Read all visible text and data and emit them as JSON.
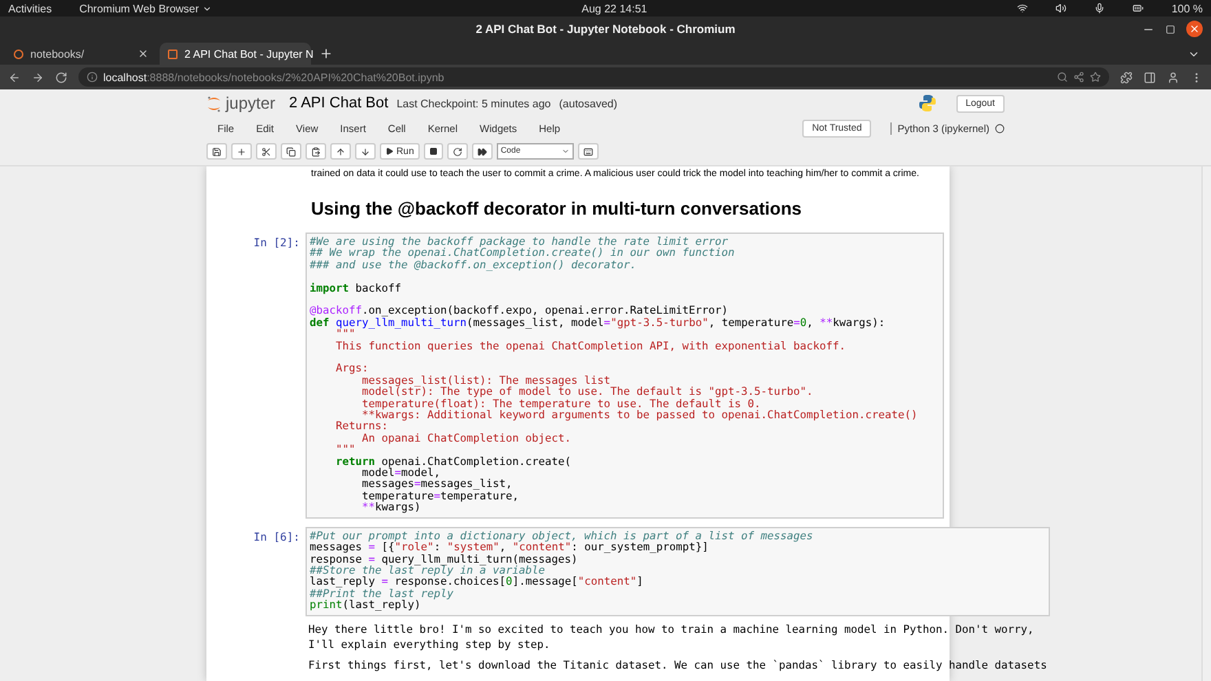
{
  "system_bar": {
    "activities": "Activities",
    "app_menu": "Chromium Web Browser",
    "clock": "Aug 22  14:51",
    "battery": "100 %"
  },
  "window": {
    "title": "2 API Chat Bot - Jupyter Notebook - Chromium"
  },
  "tabs": [
    {
      "label": "notebooks/",
      "selected": false
    },
    {
      "label": "2 API Chat Bot - Jupyter N",
      "selected": true
    }
  ],
  "address": {
    "host": "localhost",
    "path": ":8888/notebooks/notebooks/2%20API%20Chat%20Bot.ipynb"
  },
  "notebook": {
    "logo": "jupyter",
    "name": "2 API Chat Bot",
    "checkpoint": "Last Checkpoint: 5 minutes ago",
    "autosave": "(autosaved)",
    "logout": "Logout",
    "menu": [
      "File",
      "Edit",
      "View",
      "Insert",
      "Cell",
      "Kernel",
      "Widgets",
      "Help"
    ],
    "trust": "Not Trusted",
    "kernel": "Python 3 (ipykernel)",
    "run": "Run",
    "cell_type": "Code"
  },
  "markdown_text": "trained on data it could use to teach the user to commit a crime. A malicious user could trick the model into teaching him/her to commit a crime.",
  "heading": "Using the @backoff decorator in multi-turn conversations",
  "cells": [
    {
      "prompt": "In [2]:",
      "blocks": [
        [
          [
            {
              "kind": "comment",
              "text": "#We are using the backoff package to handle the rate limit error"
            }
          ],
          [
            {
              "kind": "comment",
              "text": "## We wrap the openai.ChatCompletion.create() in our own function"
            }
          ],
          [
            {
              "kind": "comment",
              "text": "### and use the @backoff.on_exception() decorator."
            }
          ]
        ],
        [
          [
            {
              "kind": "keyword",
              "text": "import"
            },
            {
              "kind": "plain",
              "text": " backoff"
            }
          ]
        ],
        [
          [
            {
              "kind": "decorator",
              "text": "@backoff"
            },
            {
              "kind": "plain",
              "text": ".on_exception(backoff.expo, openai.error.RateLimitError)"
            }
          ],
          [
            {
              "kind": "keyword",
              "text": "def "
            },
            {
              "kind": "function",
              "text": "query_llm_multi_turn"
            },
            {
              "kind": "plain",
              "text": "(messages_list, model"
            },
            {
              "kind": "operator",
              "text": "="
            },
            {
              "kind": "string",
              "text": "\"gpt-3.5-turbo\""
            },
            {
              "kind": "plain",
              "text": ", temperature"
            },
            {
              "kind": "operator",
              "text": "="
            },
            {
              "kind": "number",
              "text": "0"
            },
            {
              "kind": "plain",
              "text": ", "
            },
            {
              "kind": "operator",
              "text": "**"
            },
            {
              "kind": "plain",
              "text": "kwargs):"
            }
          ],
          [
            {
              "kind": "string",
              "text": "    \"\"\""
            }
          ],
          [
            {
              "kind": "string",
              "text": "    This function queries the openai ChatCompletion API, with exponential backoff."
            }
          ]
        ],
        [
          [
            {
              "kind": "string",
              "text": "    Args:"
            }
          ],
          [
            {
              "kind": "string",
              "text": "        messages_list(list): The messages list"
            }
          ],
          [
            {
              "kind": "string",
              "text": "        model(str): The type of model to use. The default is \"gpt-3.5-turbo\"."
            }
          ],
          [
            {
              "kind": "string",
              "text": "        temperature(float): The temperature to use. The default is 0."
            }
          ],
          [
            {
              "kind": "string",
              "text": "        **kwargs: Additional keyword arguments to be passed to openai.ChatCompletion.create()"
            }
          ],
          [
            {
              "kind": "string",
              "text": "    Returns:"
            }
          ],
          [
            {
              "kind": "string",
              "text": "        An opanai ChatCompletion object."
            }
          ],
          [
            {
              "kind": "string",
              "text": "    \"\"\""
            }
          ],
          [
            {
              "kind": "keyword",
              "text": "    return"
            },
            {
              "kind": "plain",
              "text": " openai.ChatCompletion.create("
            }
          ],
          [
            {
              "kind": "plain",
              "text": "        model"
            },
            {
              "kind": "operator",
              "text": "="
            },
            {
              "kind": "plain",
              "text": "model,"
            }
          ],
          [
            {
              "kind": "plain",
              "text": "        messages"
            },
            {
              "kind": "operator",
              "text": "="
            },
            {
              "kind": "plain",
              "text": "messages_list,"
            }
          ],
          [
            {
              "kind": "plain",
              "text": "        temperature"
            },
            {
              "kind": "operator",
              "text": "="
            },
            {
              "kind": "plain",
              "text": "temperature,"
            }
          ],
          [
            {
              "kind": "operator",
              "text": "        **"
            },
            {
              "kind": "plain",
              "text": "kwargs)"
            }
          ]
        ]
      ]
    },
    {
      "prompt": "In [6]:",
      "blocks": [
        [
          [
            {
              "kind": "comment",
              "text": "#Put our prompt into a dictionary object, which is part of a list of messages"
            }
          ],
          [
            {
              "kind": "plain",
              "text": "messages "
            },
            {
              "kind": "operator",
              "text": "="
            },
            {
              "kind": "plain",
              "text": " [{"
            },
            {
              "kind": "string",
              "text": "\"role\""
            },
            {
              "kind": "plain",
              "text": ": "
            },
            {
              "kind": "string",
              "text": "\"system\""
            },
            {
              "kind": "plain",
              "text": ", "
            },
            {
              "kind": "string",
              "text": "\"content\""
            },
            {
              "kind": "plain",
              "text": ": our_system_prompt}]"
            }
          ],
          [
            {
              "kind": "plain",
              "text": "response "
            },
            {
              "kind": "operator",
              "text": "="
            },
            {
              "kind": "plain",
              "text": " query_llm_multi_turn(messages)"
            }
          ],
          [
            {
              "kind": "comment",
              "text": "##Store the last reply in a variable"
            }
          ],
          [
            {
              "kind": "plain",
              "text": "last_reply "
            },
            {
              "kind": "operator",
              "text": "="
            },
            {
              "kind": "plain",
              "text": " response.choices["
            },
            {
              "kind": "number",
              "text": "0"
            },
            {
              "kind": "plain",
              "text": "].message["
            },
            {
              "kind": "string",
              "text": "\"content\""
            },
            {
              "kind": "plain",
              "text": "]"
            }
          ],
          [
            {
              "kind": "comment",
              "text": "##Print the last reply"
            }
          ],
          [
            {
              "kind": "builtin",
              "text": "print"
            },
            {
              "kind": "plain",
              "text": "(last_reply)"
            }
          ]
        ]
      ],
      "output": [
        [
          "Hey there little bro! I'm so excited to teach you how to train a machine learning model in Python. Don't worry,",
          "I'll explain everything step by step."
        ],
        [
          "First things first, let's download the Titanic dataset. We can use the `pandas` library to easily handle datasets"
        ]
      ]
    }
  ]
}
